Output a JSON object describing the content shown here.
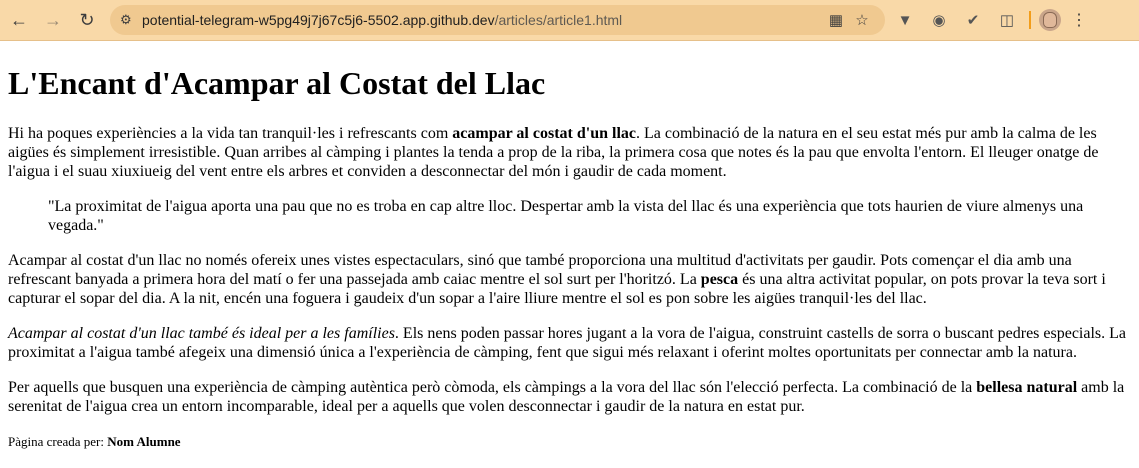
{
  "browser": {
    "url_host": "potential-telegram-w5pg49j7j67c5j6-5502.app.github.dev",
    "url_path": "/articles/article1.html"
  },
  "article": {
    "title": "L'Encant d'Acampar al Costat del Llac",
    "p1_a": "Hi ha poques experiències a la vida tan tranquil·les i refrescants com ",
    "p1_bold": "acampar al costat d'un llac",
    "p1_b": ". La combinació de la natura en el seu estat més pur amb la calma de les aigües és simplement irresistible. Quan arribes al càmping i plantes la tenda a prop de la riba, la primera cosa que notes és la pau que envolta l'entorn. El lleuger onatge de l'aigua i el suau xiuxiueig del vent entre els arbres et conviden a desconnectar del món i gaudir de cada moment.",
    "quote": "\"La proximitat de l'aigua aporta una pau que no es troba en cap altre lloc. Despertar amb la vista del llac és una experiència que tots haurien de viure almenys una vegada.\"",
    "p2_a": "Acampar al costat d'un llac no només ofereix unes vistes espectaculars, sinó que també proporciona una multitud d'activitats per gaudir. Pots començar el dia amb una refrescant banyada a primera hora del matí o fer una passejada amb caiac mentre el sol surt per l'horitzó. La ",
    "p2_bold": "pesca",
    "p2_b": " és una altra activitat popular, on pots provar la teva sort i capturar el sopar del dia. A la nit, encén una foguera i gaudeix d'un sopar a l'aire lliure mentre el sol es pon sobre les aigües tranquil·les del llac.",
    "p3_italic": "Acampar al costat d'un llac també és ideal per a les famílies",
    "p3_b": ". Els nens poden passar hores jugant a la vora de l'aigua, construint castells de sorra o buscant pedres especials. La proximitat a l'aigua també afegeix una dimensió única a l'experiència de càmping, fent que sigui més relaxant i oferint moltes oportunitats per connectar amb la natura.",
    "p4_a": "Per aquells que busquen una experiència de càmping autèntica però còmoda, els càmpings a la vora del llac són l'elecció perfecta. La combinació de la ",
    "p4_bold": "bellesa natural",
    "p4_b": " amb la serenitat de l'aigua crea un entorn incomparable, ideal per a aquells que volen desconnectar i gaudir de la natura en estat pur.",
    "footer_label": "Pàgina creada per: ",
    "footer_author": "Nom Alumne"
  }
}
